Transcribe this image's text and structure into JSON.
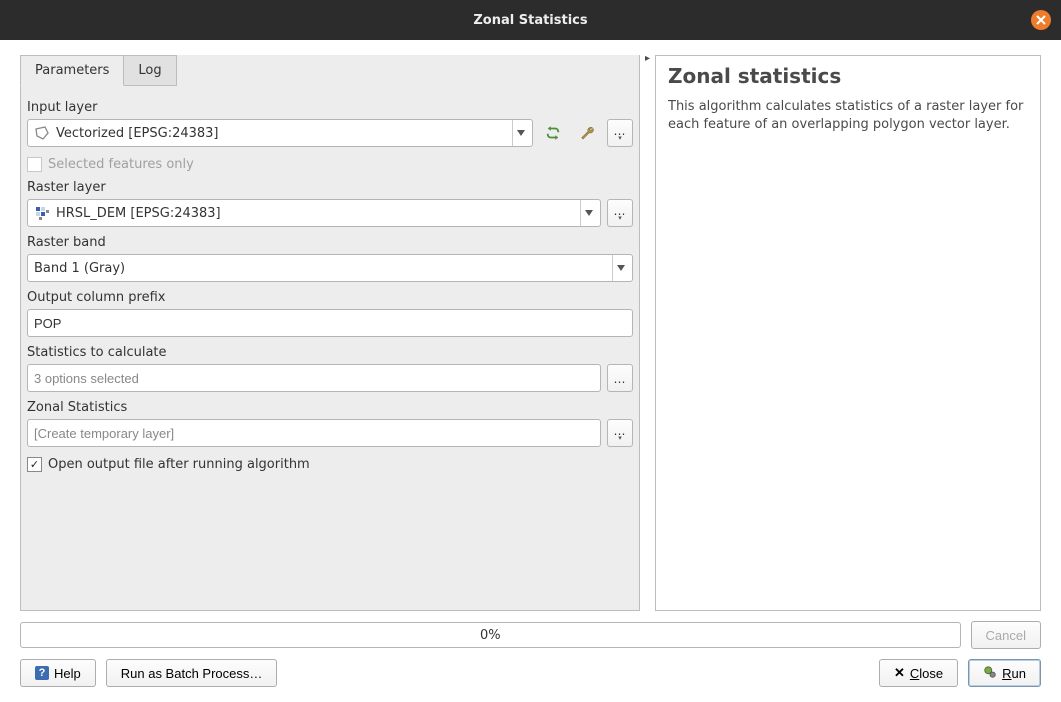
{
  "window": {
    "title": "Zonal Statistics"
  },
  "tabs": {
    "parameters": "Parameters",
    "log": "Log"
  },
  "params": {
    "input_layer": {
      "label": "Input layer",
      "value": "Vectorized [EPSG:24383]"
    },
    "selected_only": {
      "label": "Selected features only"
    },
    "raster_layer": {
      "label": "Raster layer",
      "value": "HRSL_DEM [EPSG:24383]"
    },
    "raster_band": {
      "label": "Raster band",
      "value": "Band 1 (Gray)"
    },
    "prefix": {
      "label": "Output column prefix",
      "value": "POP"
    },
    "stats": {
      "label": "Statistics to calculate",
      "value": "3 options selected"
    },
    "output": {
      "label": "Zonal Statistics",
      "placeholder": "[Create temporary layer]"
    },
    "open_after": {
      "label": "Open output file after running algorithm"
    }
  },
  "help": {
    "title": "Zonal statistics",
    "text": "This algorithm calculates statistics of a raster layer for each feature of an overlapping polygon vector layer."
  },
  "progress": {
    "text": "0%"
  },
  "buttons": {
    "cancel": "Cancel",
    "help": "Help",
    "batch": "Run as Batch Process…",
    "close": "lose",
    "close_accel": "C",
    "run": "un",
    "run_accel": "R"
  }
}
